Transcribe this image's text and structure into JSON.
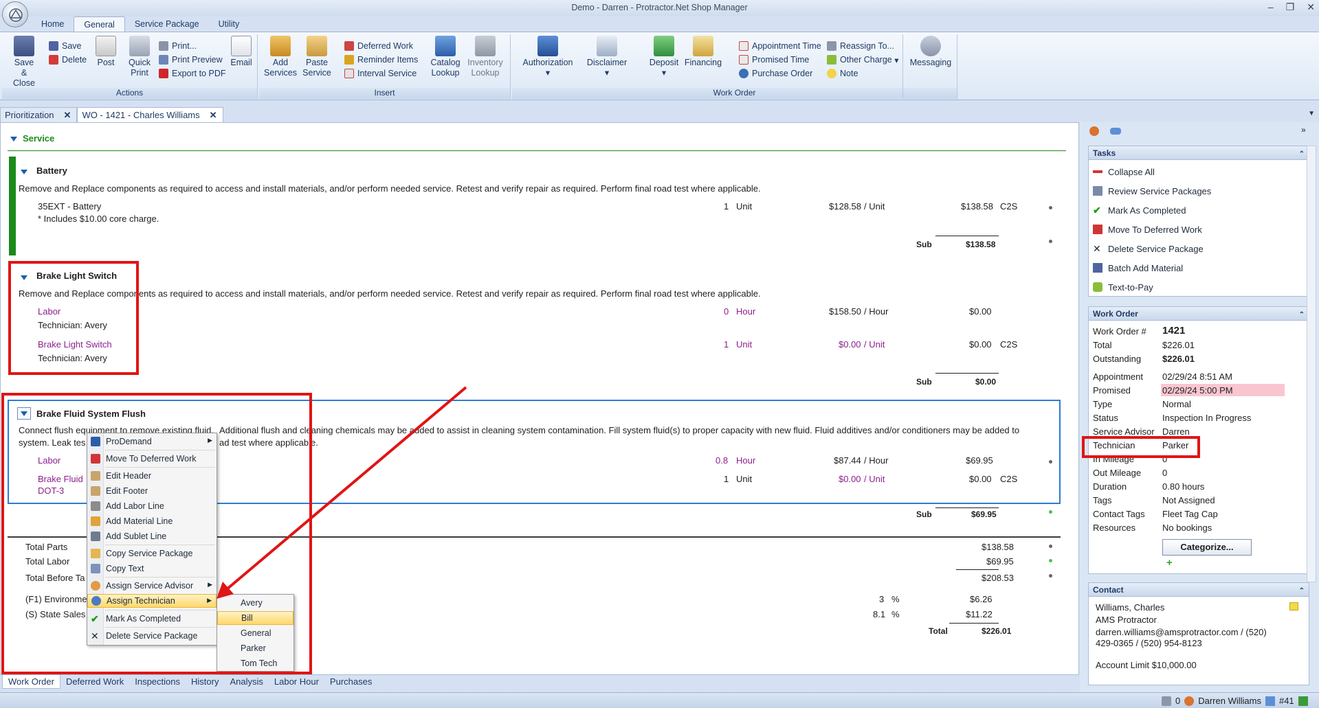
{
  "window": {
    "title": "Demo - Darren - Protractor.Net Shop Manager"
  },
  "ribbon_tabs": [
    "Home",
    "General",
    "Service Package",
    "Utility"
  ],
  "ribbon": {
    "actions": {
      "label": "Actions",
      "save_close": "Save &",
      "save_close2": "Close",
      "save": "Save",
      "delete": "Delete",
      "post": "Post",
      "quick_print": "Quick",
      "quick_print2": "Print",
      "print": "Print...",
      "print_preview": "Print Preview",
      "export_pdf": "Export to PDF",
      "email": "Email"
    },
    "insert": {
      "label": "Insert",
      "add_services": "Add",
      "add_services2": "Services",
      "paste_service": "Paste",
      "paste_service2": "Service",
      "deferred_work": "Deferred Work",
      "reminder_items": "Reminder Items",
      "interval_service": "Interval Service",
      "catalog_lookup": "Catalog",
      "catalog_lookup2": "Lookup",
      "inventory_lookup": "Inventory",
      "inventory_lookup2": "Lookup"
    },
    "work_order": {
      "label": "Work Order",
      "authorization": "Authorization",
      "disclaimer": "Disclaimer",
      "deposit": "Deposit",
      "financing": "Financing",
      "appointment_time": "Appointment Time",
      "promised_time": "Promised Time",
      "purchase_order": "Purchase Order",
      "reassign_to": "Reassign To...",
      "other_charge": "Other Charge",
      "note": "Note",
      "messaging": "Messaging"
    }
  },
  "doc_tabs": [
    "Prioritization",
    "WO - 1421 - Charles Williams"
  ],
  "service": {
    "section_title": "Service",
    "battery": {
      "title": "Battery",
      "description": "Remove and Replace components as required to access and install materials, and/or perform needed service.  Retest and verify repair as required.  Perform final road test where applicable.",
      "part": "35EXT - Battery",
      "note": "* Includes $10.00 core charge.",
      "qty": "1",
      "unit": "Unit",
      "price": "$128.58",
      "per": "/ Unit",
      "amount": "$138.58",
      "code": "C2S",
      "sub_label": "Sub",
      "sub_value": "$138.58"
    },
    "brake_light": {
      "title": "Brake Light Switch",
      "description": "Remove and Replace components as required to access and install materials, and/or perform needed service.  Retest and verify repair as required.  Perform final road test where applicable.",
      "labor": "Labor",
      "labor_tech": "Technician: Avery",
      "labor_qty": "0",
      "labor_unit": "Hour",
      "labor_price": "$158.50",
      "labor_per": "/ Hour",
      "labor_amount": "$0.00",
      "part": "Brake Light Switch",
      "part_tech": "Technician: Avery",
      "part_qty": "1",
      "part_unit": "Unit",
      "part_price": "$0.00",
      "part_per": "/ Unit",
      "part_amount": "$0.00",
      "part_code": "C2S",
      "sub_label": "Sub",
      "sub_value": "$0.00"
    },
    "brake_fluid": {
      "title": "Brake Fluid System Flush",
      "description_1a": "Connect flush equipment to remove existing fluid.",
      "description_1b": "Additional flush and cleaning chemicals may be added to assist in cleaning system contamination.  Fill system fluid(s) to proper capacity with new fluid.  Fluid additives and/or conditioners may be added to",
      "description_2a": "system.  Leak tes",
      "description_2b": "ad test where applicable.",
      "labor": "Labor",
      "labor_qty": "0.8",
      "labor_unit": "Hour",
      "labor_price": "$87.44",
      "labor_per": "/ Hour",
      "labor_amount": "$69.95",
      "part_1": "Brake Fluid",
      "part_2": "DOT-3",
      "part_qty": "1",
      "part_unit": "Unit",
      "part_price": "$0.00",
      "part_per": "/ Unit",
      "part_amount": "$0.00",
      "part_code": "C2S",
      "sub_label": "Sub",
      "sub_value": "$69.95"
    }
  },
  "totals": {
    "total_parts": "Total Parts",
    "total_parts_value": "$138.58",
    "total_labor": "Total Labor",
    "total_labor_value": "$69.95",
    "total_before_tax": "Total Before Ta",
    "total_before_tax_value": "$208.53",
    "env": "(F1) Environme",
    "env_rate": "3",
    "env_pct": "%",
    "env_value": "$6.26",
    "state_tax": "(S) State Sales",
    "state_rate": "8.1",
    "state_pct": "%",
    "state_value": "$11.22",
    "total_label": "Total",
    "total_value": "$226.01"
  },
  "context_menu": [
    "ProDemand",
    "Move To Deferred Work",
    "Edit Header",
    "Edit Footer",
    "Add Labor Line",
    "Add Material Line",
    "Add Sublet Line",
    "Copy Service Package",
    "Copy Text",
    "Assign Service Advisor",
    "Assign Technician",
    "Mark As Completed",
    "Delete Service Package"
  ],
  "technician_menu": [
    "Avery",
    "Bill",
    "General",
    "Parker",
    "Tom Tech"
  ],
  "bottom_tabs": [
    "Work Order",
    "Deferred Work",
    "Inspections",
    "History",
    "Analysis",
    "Labor Hour",
    "Purchases"
  ],
  "tasks": {
    "header": "Tasks",
    "items": [
      "Collapse All",
      "Review Service Packages",
      "Mark As Completed",
      "Move To Deferred Work",
      "Delete Service Package",
      "Batch Add Material",
      "Text-to-Pay"
    ]
  },
  "work_order_panel": {
    "header": "Work Order",
    "rows": [
      {
        "k": "Work Order #",
        "v": "1421"
      },
      {
        "k": "Total",
        "v": "$226.01"
      },
      {
        "k": "Outstanding",
        "v": "$226.01"
      },
      {
        "k": "Appointment",
        "v": "02/29/24 8:51 AM"
      },
      {
        "k": "Promised",
        "v": "02/29/24 5:00 PM"
      },
      {
        "k": "Type",
        "v": "Normal"
      },
      {
        "k": "Status",
        "v": "Inspection In Progress"
      },
      {
        "k": "Service Advisor",
        "v": "Darren"
      },
      {
        "k": "Technician",
        "v": "Parker"
      },
      {
        "k": "In Mileage",
        "v": "0"
      },
      {
        "k": "Out Mileage",
        "v": "0"
      },
      {
        "k": "Duration",
        "v": "0.80 hours"
      },
      {
        "k": "Tags",
        "v": "Not Assigned"
      },
      {
        "k": "Contact Tags",
        "v": "Fleet Tag Cap"
      },
      {
        "k": "Resources",
        "v": "No bookings"
      }
    ],
    "categorize": "Categorize..."
  },
  "contact_panel": {
    "header": "Contact",
    "name": "Williams, Charles",
    "company": "AMS Protractor",
    "line1": "darren.williams@amsprotractor.com / (520)",
    "line2": "429-0365 / (520) 954-8123",
    "credit": "Account Limit $10,000.00"
  },
  "status_bar": {
    "count": "0",
    "user": "Darren Williams",
    "number": "#41"
  },
  "colors": {
    "accent_red": "#e01515",
    "purple_text": "#8b1f8b",
    "service_green": "#1b8a1b",
    "promised_bg": "#f9c6d0"
  }
}
